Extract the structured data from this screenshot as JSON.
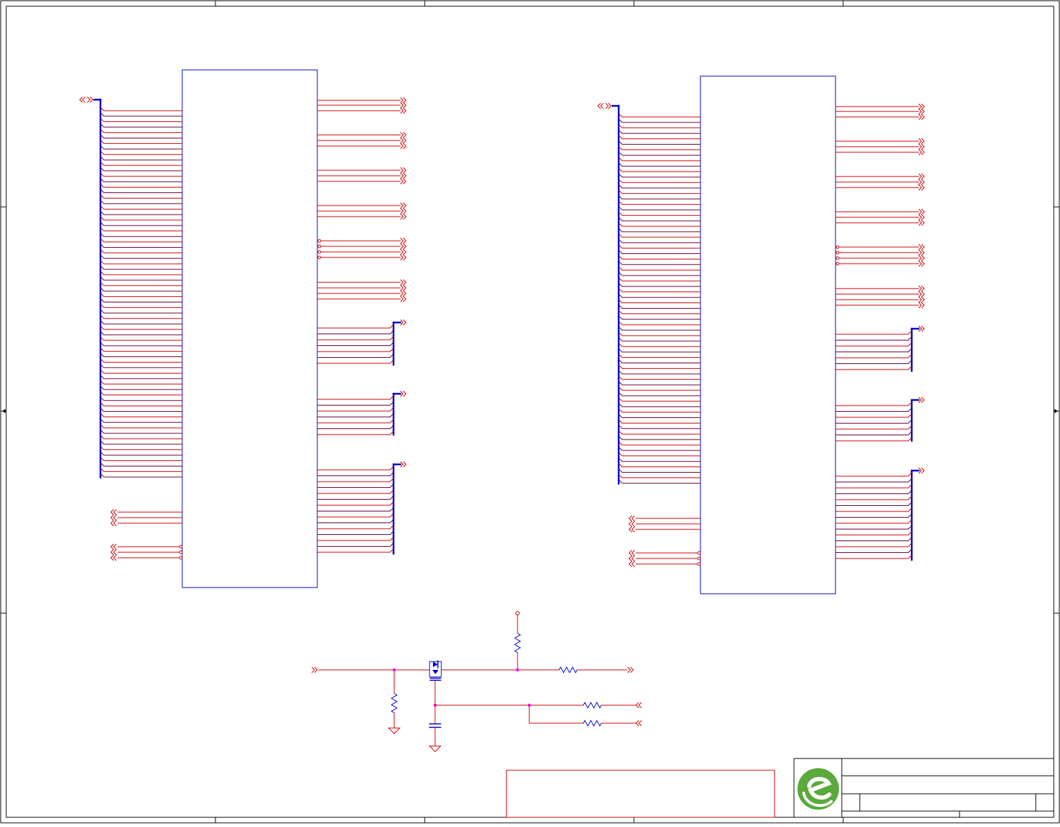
{
  "colors": {
    "background": "#ffffff",
    "border": "#000000",
    "component_outline": "#0000cc",
    "bus": "#0000cc",
    "wire": "#cc0000",
    "wire_alt": "#660033",
    "port": "#cc0000",
    "junction": "#ff00ff",
    "logo_green": "#5aaa3c"
  },
  "sheet": {
    "zone_border_ticks": true,
    "title_block": {
      "logo_icon": "green-e-logo",
      "fields_text_visible": false
    },
    "notes_box": {
      "text_visible": false
    }
  },
  "schematic": {
    "component_blocks": 2,
    "bus_ports_left_per_block": 1,
    "single_ports_left_per_block": 5,
    "double_ports_right_per_block": 20,
    "bus_ports_right_per_block": 3,
    "bottom_circuit": {
      "resistors": 5,
      "capacitors": 1,
      "diode_switch": 1,
      "grounds": 2,
      "power_pins": 1,
      "ports": 4
    }
  }
}
